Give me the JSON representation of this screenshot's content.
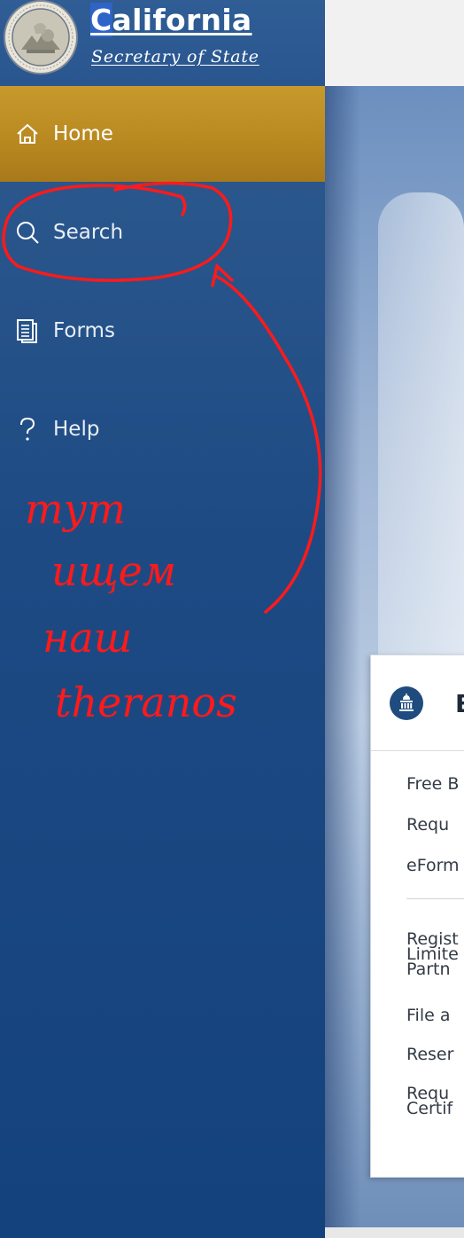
{
  "header": {
    "brand_title_part1": "C",
    "brand_title_part2": "alifornia",
    "brand_subtitle": "Secretary of State",
    "seal": "california-state-seal"
  },
  "sidebar": {
    "items": [
      {
        "label": "Home",
        "icon": "home-icon",
        "active": true
      },
      {
        "label": "Search",
        "icon": "search-icon",
        "active": false
      },
      {
        "label": "Forms",
        "icon": "forms-icon",
        "active": false
      },
      {
        "label": "Help",
        "icon": "help-icon",
        "active": false
      }
    ]
  },
  "card": {
    "icon": "capitol-building-icon",
    "title": "B",
    "links_group1": [
      "Free B",
      "Requ",
      "eForm"
    ],
    "links_group2": [
      "Regist\nLimite\nPartn",
      "File a",
      "Reser",
      "Requ\nCertif"
    ]
  },
  "annotation": {
    "text_line1": "тут",
    "text_line2": "ищем",
    "text_line3": "наш",
    "text_line4": "theranos",
    "color": "#ff1a1a"
  },
  "colors": {
    "sidebar": "#1e4a84",
    "active_item": "#b88820",
    "header": "#2f5d94"
  }
}
